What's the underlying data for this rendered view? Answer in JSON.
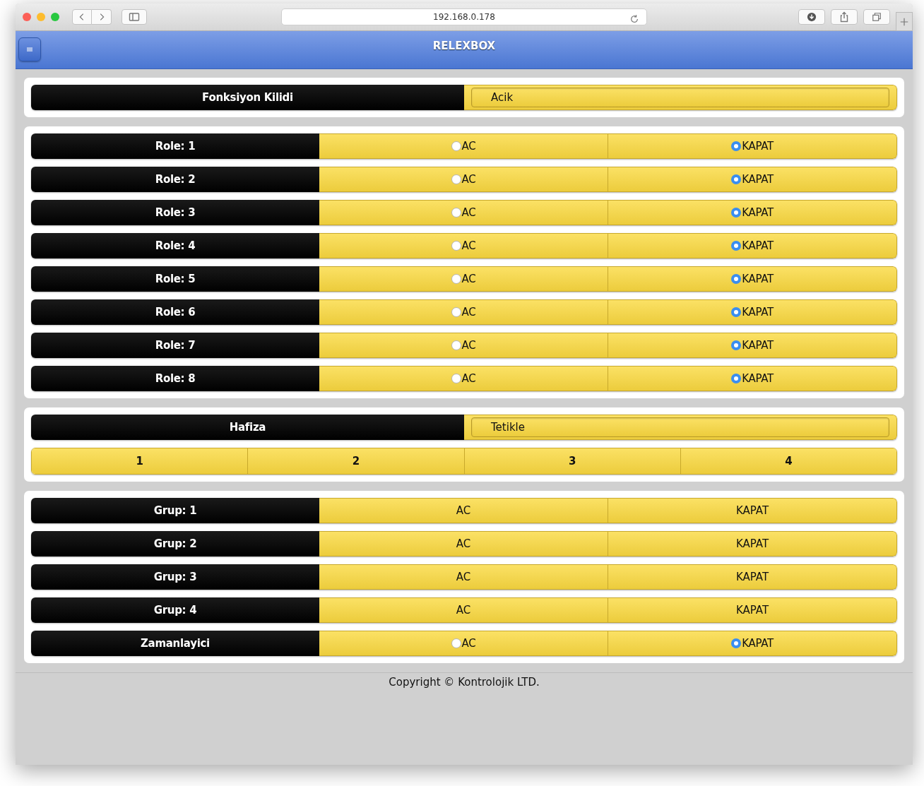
{
  "browser": {
    "address": "192.168.0.178"
  },
  "header": {
    "title": "RELEXBOX"
  },
  "lock": {
    "label": "Fonksiyon Kilidi",
    "value": "Acik"
  },
  "relays": [
    {
      "label": "Role: 1",
      "options": [
        {
          "label": "AC",
          "selected": false
        },
        {
          "label": "KAPAT",
          "selected": true
        }
      ]
    },
    {
      "label": "Role: 2",
      "options": [
        {
          "label": "AC",
          "selected": false
        },
        {
          "label": "KAPAT",
          "selected": true
        }
      ]
    },
    {
      "label": "Role: 3",
      "options": [
        {
          "label": "AC",
          "selected": false
        },
        {
          "label": "KAPAT",
          "selected": true
        }
      ]
    },
    {
      "label": "Role: 4",
      "options": [
        {
          "label": "AC",
          "selected": false
        },
        {
          "label": "KAPAT",
          "selected": true
        }
      ]
    },
    {
      "label": "Role: 5",
      "options": [
        {
          "label": "AC",
          "selected": false
        },
        {
          "label": "KAPAT",
          "selected": true
        }
      ]
    },
    {
      "label": "Role: 6",
      "options": [
        {
          "label": "AC",
          "selected": false
        },
        {
          "label": "KAPAT",
          "selected": true
        }
      ]
    },
    {
      "label": "Role: 7",
      "options": [
        {
          "label": "AC",
          "selected": false
        },
        {
          "label": "KAPAT",
          "selected": true
        }
      ]
    },
    {
      "label": "Role: 8",
      "options": [
        {
          "label": "AC",
          "selected": false
        },
        {
          "label": "KAPAT",
          "selected": true
        }
      ]
    }
  ],
  "memory": {
    "label": "Hafiza",
    "value": "Tetikle",
    "slots": [
      "1",
      "2",
      "3",
      "4"
    ]
  },
  "groups": [
    {
      "kind": "buttons",
      "label": "Grup: 1",
      "options": [
        {
          "label": "AC"
        },
        {
          "label": "KAPAT"
        }
      ]
    },
    {
      "kind": "buttons",
      "label": "Grup: 2",
      "options": [
        {
          "label": "AC"
        },
        {
          "label": "KAPAT"
        }
      ]
    },
    {
      "kind": "buttons",
      "label": "Grup: 3",
      "options": [
        {
          "label": "AC"
        },
        {
          "label": "KAPAT"
        }
      ]
    },
    {
      "kind": "buttons",
      "label": "Grup: 4",
      "options": [
        {
          "label": "AC"
        },
        {
          "label": "KAPAT"
        }
      ]
    },
    {
      "kind": "radio",
      "label": "Zamanlayici",
      "options": [
        {
          "label": "AC",
          "selected": false
        },
        {
          "label": "KAPAT",
          "selected": true
        }
      ]
    }
  ],
  "footer": "Copyright © Kontrolojik LTD."
}
